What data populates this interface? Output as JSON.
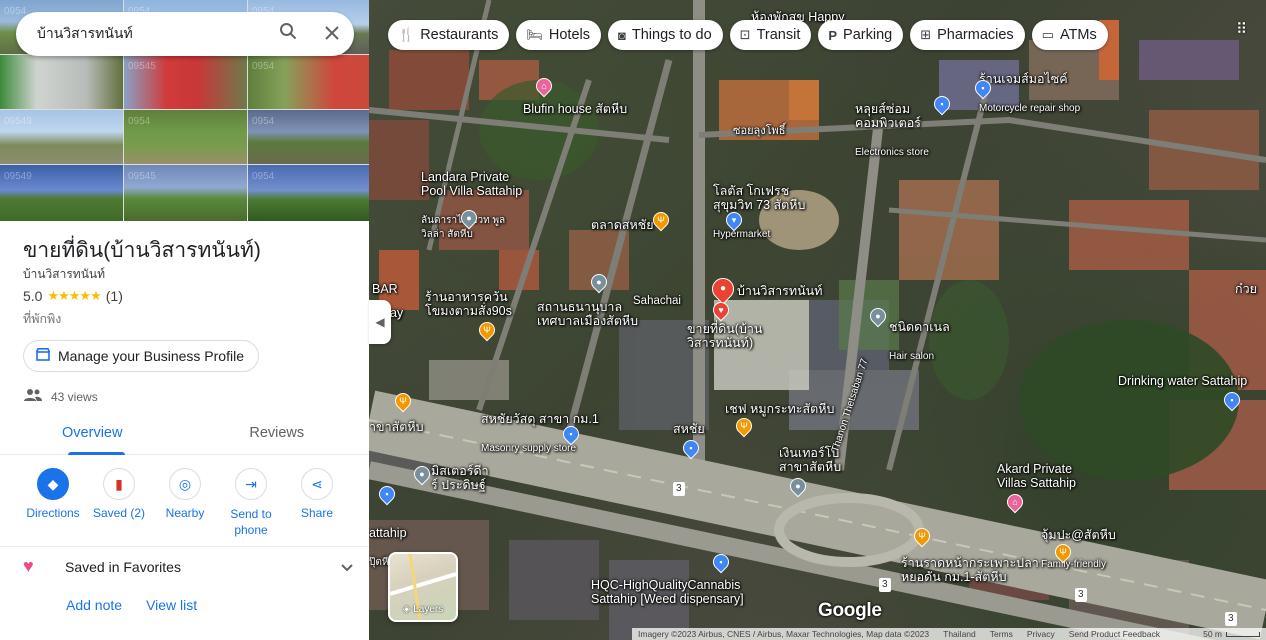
{
  "search": {
    "query": "บ้านวิสารทนันท์",
    "search_icon": "search-icon",
    "close_icon": "close-icon"
  },
  "photos": {
    "watermarks": [
      "0954",
      "0954",
      "0954",
      "",
      "09545",
      "0954",
      "09549",
      "0954",
      "0954",
      "09549",
      "09545",
      "0954"
    ]
  },
  "place": {
    "title": "ขายที่ดิน(บ้านวิสารทนันท์)",
    "subtitle": "บ้านวิสารทนันท์",
    "rating": "5.0",
    "stars": "★★★★★",
    "review_count": "(1)",
    "category": "ที่พักพิง"
  },
  "manage_profile": {
    "label": "Manage your Business Profile",
    "icon": "storefront-icon"
  },
  "views": {
    "label": "43 views",
    "icon": "people-icon"
  },
  "tabs": [
    {
      "label": "Overview",
      "active": true
    },
    {
      "label": "Reviews",
      "active": false
    }
  ],
  "actions": [
    {
      "label": "Directions",
      "glyph": "◆"
    },
    {
      "label": "Saved (2)",
      "glyph": "▮"
    },
    {
      "label": "Nearby",
      "glyph": "◎"
    },
    {
      "label": "Send to\nphone",
      "glyph": "⇥"
    },
    {
      "label": "Share",
      "glyph": "⋖"
    }
  ],
  "saved": {
    "label": "Saved in Favorites",
    "heart": "♥",
    "chevron": "⌄"
  },
  "links": {
    "add_note": "Add note",
    "view_list": "View list"
  },
  "chips": [
    {
      "label": "Restaurants",
      "icon": "utensils-icon",
      "glyph": "🍴"
    },
    {
      "label": "Hotels",
      "icon": "bed-icon",
      "glyph": "🛏"
    },
    {
      "label": "Things to do",
      "icon": "camera-icon",
      "glyph": "◙"
    },
    {
      "label": "Transit",
      "icon": "bus-icon",
      "glyph": "⊡"
    },
    {
      "label": "Parking",
      "icon": "parking-icon",
      "glyph": "P"
    },
    {
      "label": "Pharmacies",
      "icon": "pharmacy-icon",
      "glyph": "⊞"
    },
    {
      "label": "ATMs",
      "icon": "atm-icon",
      "glyph": "▭"
    }
  ],
  "map_labels": {
    "happy": "ห้องพักสุข Happy",
    "moto": "ร้านเจมส์มอไซค์",
    "moto_sub": "Motorcycle repair shop",
    "blufin": "Blufin house สัตหีบ",
    "computer": "หลุยส์ซ่อม\nคอมพิวเตอร์",
    "computer_sub": "Electronics store",
    "soi": "ซอยลุงโพธิ์",
    "landara": "Landara Private\nPool Villa Sattahip",
    "landara_th": "ลันดาราไพรเวท พูล\nวิลล่า สัตหีบ",
    "lotus": "โลตัส โกเฟรช\nสุขุมวิท 73 สัตหีบ",
    "lotus_sub": "Hypermarket",
    "market": "ตลาดสหชัย",
    "bar": "BAR",
    "restaurant": "ร้านอาหารควัน\nโขมงตามสั่ง90s",
    "day": "day",
    "health": "สถานธนานุบาล\nเทศบาลเมืองสัตหีบ",
    "sahachai": "Sahachai",
    "place_pin": "บ้านวิสารทนันท์",
    "place_pin2": "ขายที่ดิน(บ้าน\nวิสารทนันท์)",
    "salon": "ชนิดดาเนล",
    "salon_sub": "Hair salon",
    "kokui": "ก๋วย",
    "water": "Drinking water Sattahip",
    "masonry": "สหชัยวัสดุ สาขา กม.1",
    "masonry_sub": "Masonry supply store",
    "chef": "เชฟ หมูกระทะสัตหีบ",
    "sahachai2": "สหชัย",
    "branch": "าขาสัตหีบ",
    "ngern": "เงินเทอร์โบ\nสาขาสัตหีบ",
    "thanon": "Thanon Thetsaban 77",
    "mister": "มิสเตอร์ดีา\nร์ ประดิษฐ์",
    "akard": "Akard Private\nVillas Sattahip",
    "sattahip": "attahip",
    "sattahip_th": "ปุ๊ตหีบ",
    "jum": "จุ้มปะ@สัตหีบ",
    "jum_sub": "Family-friendly",
    "ratcha": "ร้านราดหน้ากระเพาะปลา\nหยอดัน กม.1-สัตหีบ",
    "hqc": "HQC-HighQualityCannabis\nSattahip [Weed dispensary]",
    "route1": "3",
    "route2": "3",
    "route3": "3",
    "route4": "3"
  },
  "layers_label": "Layers",
  "google": "Google",
  "footer": {
    "imagery": "Imagery ©2023 Airbus, CNES / Airbus, Maxar Technologies, Map data ©2023",
    "country": "Thailand",
    "terms": "Terms",
    "privacy": "Privacy",
    "feedback": "Send Product Feedback",
    "scale": "50 m"
  },
  "colors": {
    "accent": "#1a73e8",
    "pin_red": "#ea4335",
    "pin_orange": "#f29900",
    "pin_blue": "#4285f4",
    "pin_pink": "#e8649b",
    "pin_gray": "#78909c"
  }
}
